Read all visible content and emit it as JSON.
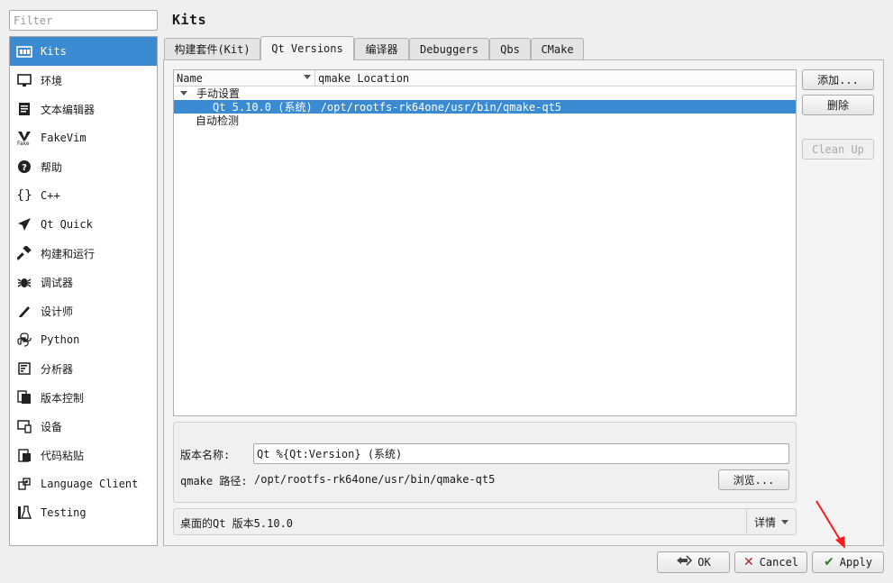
{
  "filter": {
    "placeholder": "Filter"
  },
  "sidebar": {
    "items": [
      {
        "label": "Kits",
        "icon": "kits-icon",
        "selected": true
      },
      {
        "label": "环境",
        "icon": "monitor-icon"
      },
      {
        "label": "文本编辑器",
        "icon": "text-editor-icon"
      },
      {
        "label": "FakeVim",
        "icon": "fakevim-icon"
      },
      {
        "label": "帮助",
        "icon": "help-icon"
      },
      {
        "label": "C++",
        "icon": "braces-icon"
      },
      {
        "label": "Qt Quick",
        "icon": "paper-plane-icon"
      },
      {
        "label": "构建和运行",
        "icon": "hammer-icon"
      },
      {
        "label": "调试器",
        "icon": "bug-icon"
      },
      {
        "label": "设计师",
        "icon": "pencil-icon"
      },
      {
        "label": "Python",
        "icon": "python-icon"
      },
      {
        "label": "分析器",
        "icon": "analyzer-icon"
      },
      {
        "label": "版本控制",
        "icon": "version-control-icon"
      },
      {
        "label": "设备",
        "icon": "device-icon"
      },
      {
        "label": "代码粘贴",
        "icon": "paste-icon"
      },
      {
        "label": "Language Client",
        "icon": "language-client-icon"
      },
      {
        "label": "Testing",
        "icon": "flask-icon"
      }
    ]
  },
  "page": {
    "title": "Kits"
  },
  "tabs": [
    {
      "label": "构建套件(Kit)"
    },
    {
      "label": "Qt Versions",
      "active": true
    },
    {
      "label": "编译器"
    },
    {
      "label": "Debuggers"
    },
    {
      "label": "Qbs"
    },
    {
      "label": "CMake"
    }
  ],
  "tree": {
    "columns": [
      "Name",
      "qmake Location"
    ],
    "groups": [
      {
        "label": "手动设置",
        "expanded": true,
        "rows": [
          {
            "name": "Qt 5.10.0 (系统)",
            "location": "/opt/rootfs-rk64one/usr/bin/qmake-qt5",
            "selected": true
          }
        ]
      },
      {
        "label": "自动检测",
        "expanded": false,
        "rows": []
      }
    ]
  },
  "buttons": {
    "add": "添加...",
    "remove": "删除",
    "cleanup": "Clean Up"
  },
  "details": {
    "version_name_label": "版本名称:",
    "version_name_value": "Qt %{Qt:Version} (系统)",
    "qmake_path_label": "qmake 路径:",
    "qmake_path_value": "/opt/rootfs-rk64one/usr/bin/qmake-qt5",
    "browse_label": "浏览..."
  },
  "info": {
    "text": "桌面的Qt 版本5.10.0",
    "details_label": "详情"
  },
  "dialog_buttons": {
    "ok": "OK",
    "cancel": "Cancel",
    "apply": "Apply"
  },
  "colors": {
    "selection": "#3a8bd2",
    "annotation": "#ff1a1a"
  }
}
